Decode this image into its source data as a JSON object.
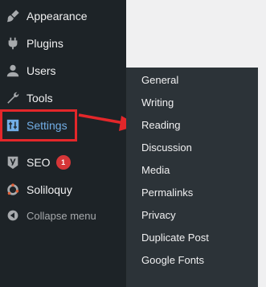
{
  "menu": {
    "items": [
      {
        "label": "Appearance",
        "icon": "paintbrush-icon"
      },
      {
        "label": "Plugins",
        "icon": "plugin-icon"
      },
      {
        "label": "Users",
        "icon": "user-icon"
      },
      {
        "label": "Tools",
        "icon": "wrench-icon"
      },
      {
        "label": "Settings",
        "icon": "settings-sliders-icon"
      },
      {
        "label": "SEO",
        "icon": "yoast-icon",
        "badge": "1"
      },
      {
        "label": "Soliloquy",
        "icon": "soliloquy-icon"
      },
      {
        "label": "Collapse menu",
        "icon": "collapse-arrow-icon"
      }
    ]
  },
  "submenu": {
    "items": [
      "General",
      "Writing",
      "Reading",
      "Discussion",
      "Media",
      "Permalinks",
      "Privacy",
      "Duplicate Post",
      "Google Fonts"
    ]
  },
  "colors": {
    "sidebar_bg": "#1d2327",
    "submenu_bg": "#2c3338",
    "accent": "#72aee6",
    "highlight": "#e3272a",
    "badge": "#d63638"
  }
}
